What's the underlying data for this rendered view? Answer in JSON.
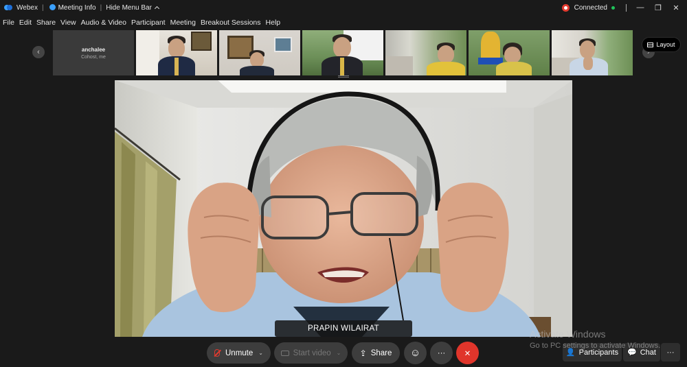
{
  "titlebar": {
    "app_name": "Webex",
    "meeting_info": "Meeting Info",
    "hide_menu_bar": "Hide Menu Bar",
    "status": "Connected",
    "minimize": "—",
    "restore": "❐",
    "close": "✕",
    "accent_color": "#3aa0ff",
    "status_color": "#1fc45a",
    "recording_color": "#e23a2f"
  },
  "menu": {
    "items": [
      "File",
      "Edit",
      "Share",
      "View",
      "Audio & Video",
      "Participant",
      "Meeting",
      "Breakout Sessions",
      "Help"
    ]
  },
  "thumbnails": {
    "prev_icon": "‹",
    "next_icon": "›",
    "first": {
      "name": "anchalee",
      "role": "Cohost, me"
    },
    "layout_label": "Layout"
  },
  "main_video": {
    "speaker_name": "PRAPIN WILAIRAT"
  },
  "controls": {
    "unmute": "Unmute",
    "start_video": "Start video",
    "share": "Share",
    "reactions_icon": "☺",
    "more_icon": "···",
    "end_icon": "✕",
    "end_color": "#e0352b",
    "participants": "Participants",
    "chat": "Chat",
    "more_right": "···"
  },
  "watermark": {
    "line1": "Activate Windows",
    "line2": "Go to PC settings to activate Windows."
  }
}
